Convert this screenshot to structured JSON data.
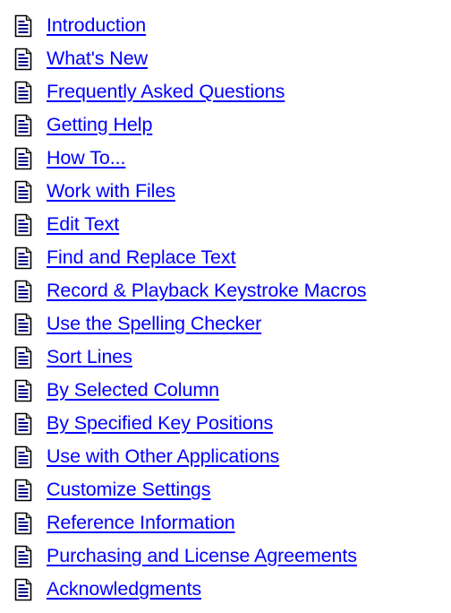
{
  "icon": "help-topic-page-icon",
  "link_color": "#0000ff",
  "topics": [
    {
      "label": "Introduction"
    },
    {
      "label": "What's New"
    },
    {
      "label": "Frequently Asked Questions"
    },
    {
      "label": "Getting Help"
    },
    {
      "label": "How To..."
    },
    {
      "label": "Work with Files"
    },
    {
      "label": "Edit Text"
    },
    {
      "label": "Find and Replace Text"
    },
    {
      "label": "Record & Playback Keystroke Macros"
    },
    {
      "label": "Use the Spelling Checker"
    },
    {
      "label": "Sort Lines"
    },
    {
      "label": "By Selected Column"
    },
    {
      "label": "By Specified Key Positions"
    },
    {
      "label": "Use with Other Applications"
    },
    {
      "label": "Customize Settings"
    },
    {
      "label": "Reference Information"
    },
    {
      "label": "Purchasing and License Agreements"
    },
    {
      "label": "Acknowledgments"
    }
  ]
}
